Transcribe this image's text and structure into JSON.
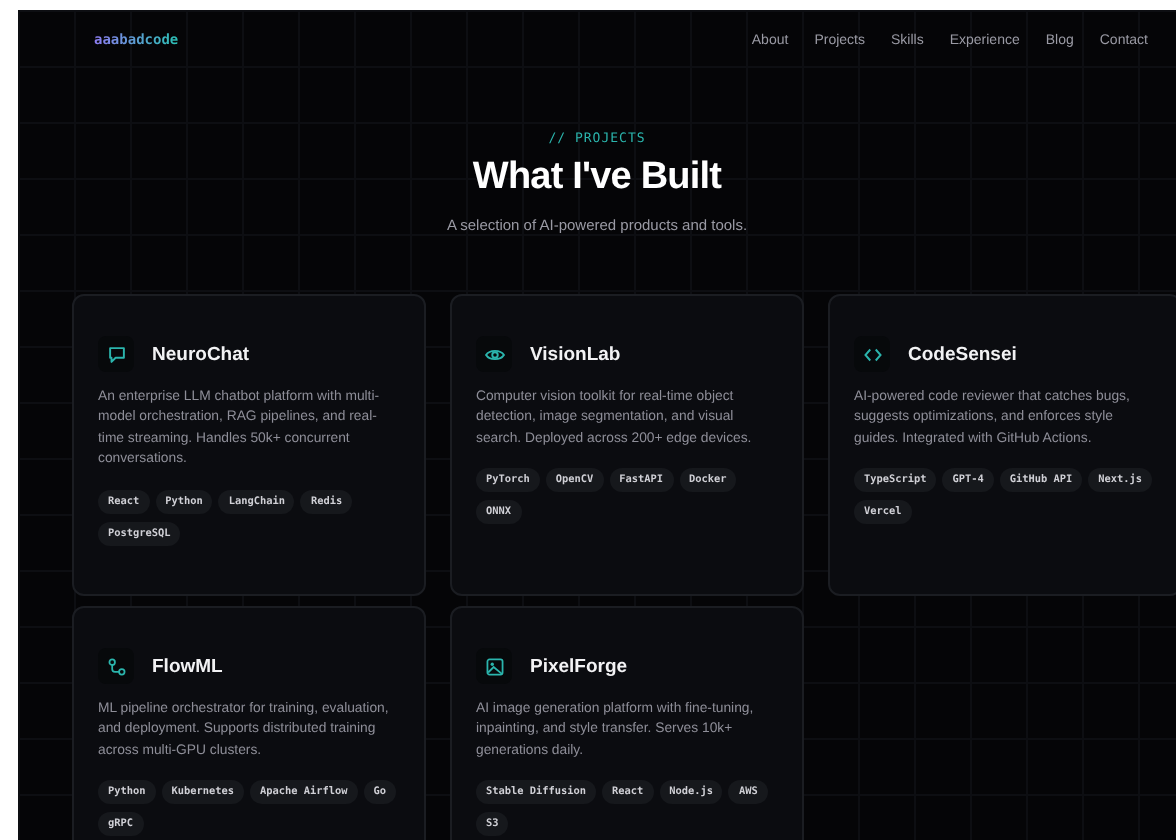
{
  "nav": {
    "logo": "aaabadcode",
    "links": [
      "About",
      "Projects",
      "Skills",
      "Experience",
      "Blog",
      "Contact"
    ]
  },
  "header": {
    "eyebrow": "// PROJECTS",
    "title": "What I've Built",
    "subtitle": "A selection of AI-powered products and tools."
  },
  "projects": [
    {
      "kind": "chat",
      "title": "NeuroChat",
      "description": "An enterprise LLM chatbot platform with multi-model orchestration, RAG pipelines, and real-time streaming. Handles 50k+ concurrent conversations.",
      "tags": [
        "React",
        "Python",
        "LangChain",
        "Redis",
        "PostgreSQL"
      ]
    },
    {
      "kind": "eye",
      "title": "VisionLab",
      "description": "Computer vision toolkit for real-time object detection, image segmentation, and visual search. Deployed across 200+ edge devices.",
      "tags": [
        "PyTorch",
        "OpenCV",
        "FastAPI",
        "Docker",
        "ONNX"
      ]
    },
    {
      "kind": "code",
      "title": "CodeSensei",
      "description": "AI-powered code reviewer that catches bugs, suggests optimizations, and enforces style guides. Integrated with GitHub Actions.",
      "tags": [
        "TypeScript",
        "GPT-4",
        "GitHub API",
        "Next.js",
        "Vercel"
      ]
    },
    {
      "kind": "flow",
      "title": "FlowML",
      "description": "ML pipeline orchestrator for training, evaluation, and deployment. Supports distributed training across multi-GPU clusters.",
      "tags": [
        "Python",
        "Kubernetes",
        "Apache Airflow",
        "Go",
        "gRPC"
      ]
    },
    {
      "kind": "image",
      "title": "PixelForge",
      "description": "AI image generation platform with fine-tuning, inpainting, and style transfer. Serves 10k+ generations daily.",
      "tags": [
        "Stable Diffusion",
        "React",
        "Node.js",
        "AWS",
        "S3"
      ]
    }
  ]
}
